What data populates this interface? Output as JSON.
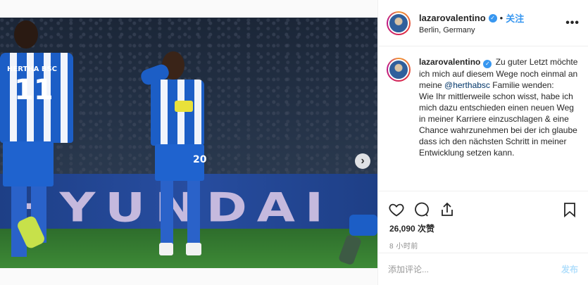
{
  "post": {
    "username": "lazarovalentino",
    "verified_icon": "verified-badge-icon",
    "separator": "•",
    "follow_label": "关注",
    "location": "Berlin, Germany",
    "more_label": "•••"
  },
  "photo": {
    "board_text": "HYUNDAI",
    "player_main_number": "20",
    "player_left_number": "11",
    "player_left_name": "HERTHA BSC",
    "next_label": "›",
    "slide_count": 4,
    "active_slide": 1
  },
  "caption": {
    "username": "lazarovalentino",
    "line_start": "Zu guter Letzt möchte ich mich auf diesem Wege noch einmal an meine ",
    "mention": "@herthabsc",
    "line_end": " Familie wenden:",
    "body": "Wie Ihr mittlerweile schon wisst, habe ich mich dazu entschieden einen neuen Weg in meiner Karriere einzuschlagen & eine Chance wahrzunehmen bei der ich glaube dass ich den nächsten Schritt in meiner Entwicklung setzen kann."
  },
  "actions": {
    "like_icon": "heart-icon",
    "comment_icon": "comment-icon",
    "share_icon": "share-icon",
    "save_icon": "bookmark-icon"
  },
  "stats": {
    "likes": "26,090 次赞",
    "time": "8 小时前"
  },
  "comment": {
    "placeholder": "添加评论...",
    "post_label": "发布"
  },
  "colors": {
    "accent": "#3897f0",
    "post_disabled": "#b2dffc",
    "text": "#262626",
    "muted": "#8e8e8e"
  }
}
